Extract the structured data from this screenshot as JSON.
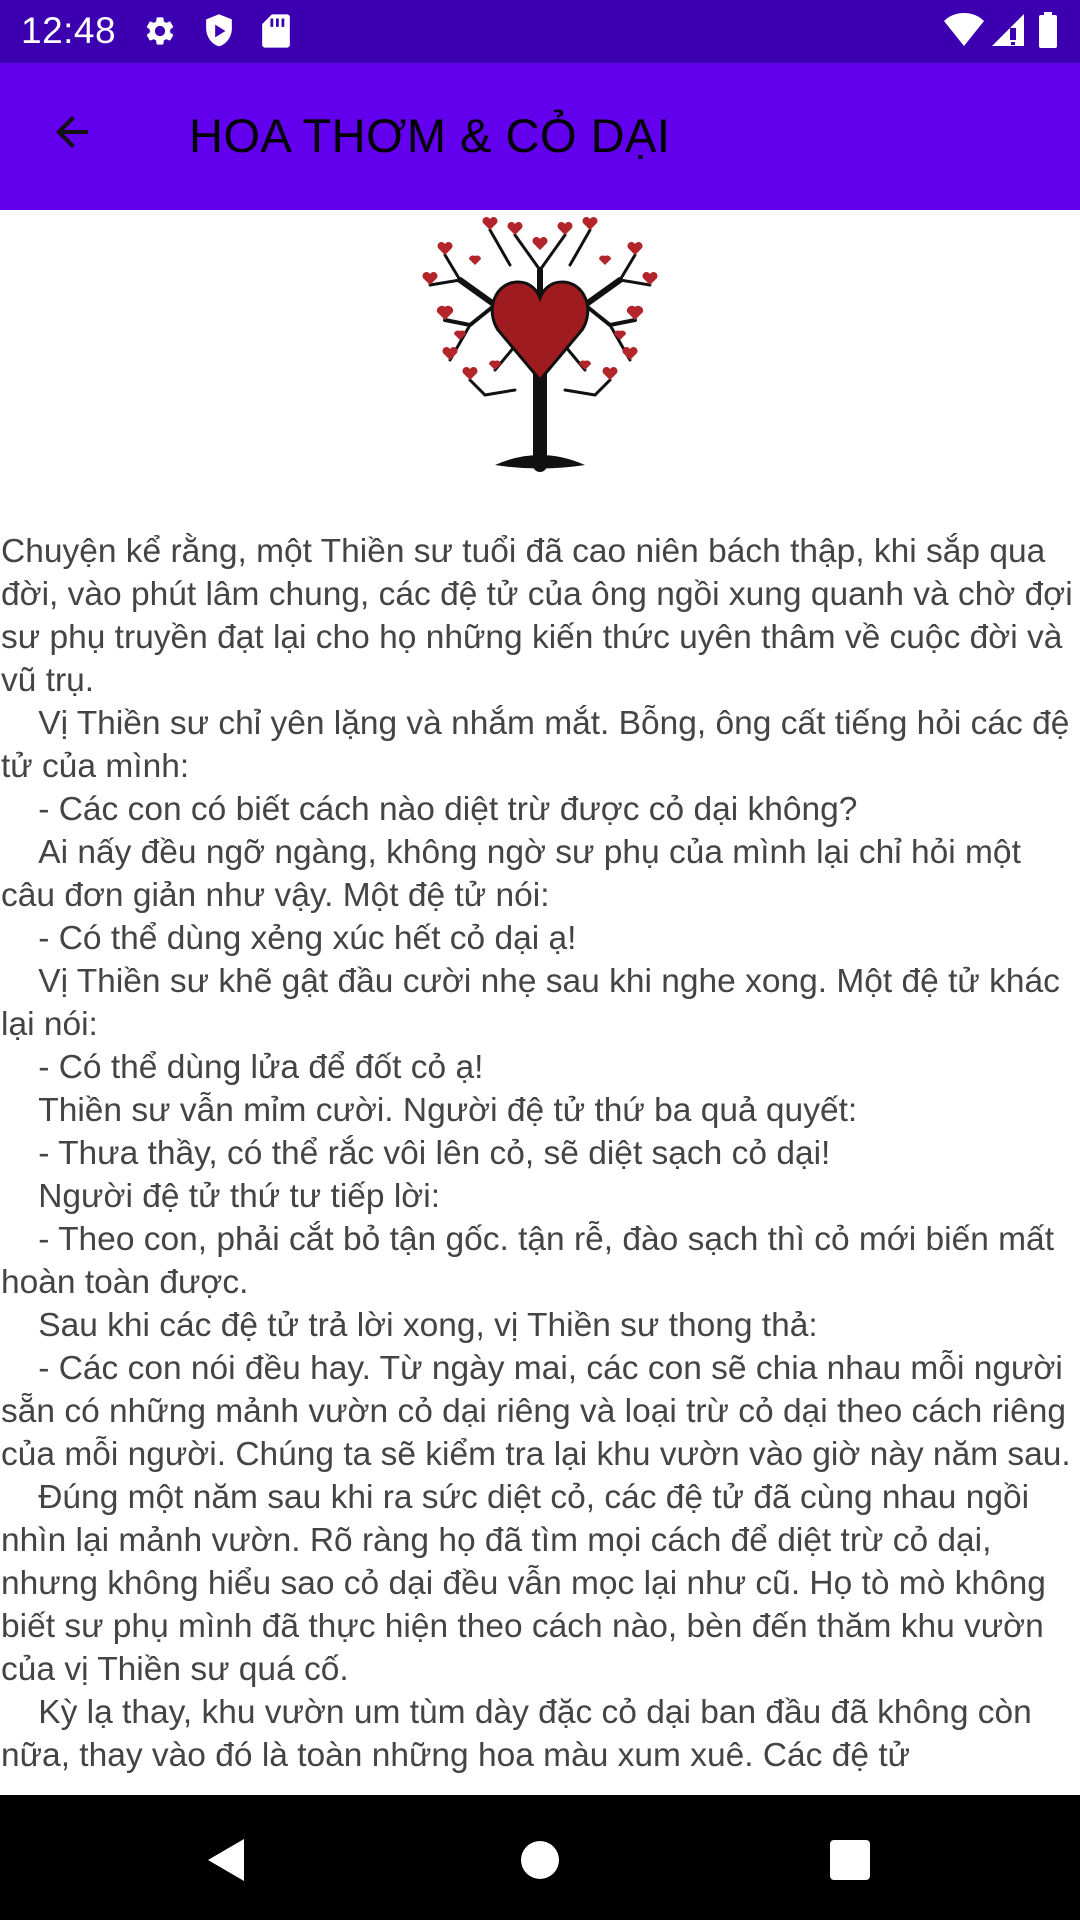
{
  "status_bar": {
    "time": "12:48",
    "icons_left": [
      "gear-icon",
      "shield-icon",
      "sd-card-icon"
    ],
    "icons_right": [
      "wifi-icon",
      "signal-icon",
      "battery-icon"
    ]
  },
  "app_bar": {
    "title": "HOA THƠM & CỎ DẠI",
    "back_icon": "arrow-back-icon"
  },
  "hero_image": {
    "icon": "heart-tree-illustration",
    "heart_color": "#9e1b1f"
  },
  "story": {
    "text": "Chuyện kể rằng, một Thiền sư tuổi đã cao niên bách thập, khi sắp qua đời, vào phút lâm chung, các đệ tử của ông ngồi xung quanh và chờ đợi sư phụ truyền đạt lại cho họ những kiến thức uyên thâm về cuộc đời và vũ trụ.\n    Vị Thiền sư chỉ yên lặng và nhắm mắt. Bỗng, ông cất tiếng hỏi các đệ tử của mình:\n    - Các con có biết cách nào diệt trừ được cỏ dại không?\n    Ai nấy đều ngỡ ngàng, không ngờ sư phụ của mình lại chỉ hỏi một câu đơn giản như vậy. Một đệ tử nói:\n    - Có thể dùng xẻng xúc hết cỏ dại ạ!\n    Vị Thiền sư khẽ gật đầu cười nhẹ sau khi nghe xong. Một đệ tử khác lại nói:\n    - Có thể dùng lửa để đốt cỏ ạ!\n    Thiền sư vẫn mỉm cười. Người đệ tử thứ ba quả quyết:\n    - Thưa thầy, có thể rắc vôi lên cỏ, sẽ diệt sạch cỏ dại!\n    Người đệ tử thứ tư tiếp lời:\n    - Theo con, phải cắt bỏ tận gốc. tận rễ, đào sạch thì cỏ mới biến mất hoàn toàn được.\n    Sau khi các đệ tử trả lời xong, vị Thiền sư thong thả:\n    - Các con nói đều hay. Từ ngày mai, các con sẽ chia nhau mỗi người sẵn có những mảnh vườn cỏ dại riêng và loại trừ cỏ dại theo cách riêng của mỗi người. Chúng ta sẽ kiểm tra lại khu vườn vào giờ này năm sau.\n    Đúng một năm sau khi ra sức diệt cỏ, các đệ tử đã cùng nhau ngồi nhìn lại mảnh vườn. Rõ ràng họ đã tìm mọi cách để diệt trừ cỏ dại, nhưng không hiểu sao cỏ dại đều vẫn mọc lại như cũ. Họ tò mò không biết sư phụ mình đã thực hiện theo cách nào, bèn đến thăm khu vườn của vị Thiền sư quá cố.\n    Kỳ lạ thay, khu vườn um tùm dày đặc cỏ dại ban đầu đã không còn nữa, thay vào đó là toàn những hoa màu xum xuê. Các đệ tử"
  },
  "nav_bar": {
    "icons": [
      "back-triangle-icon",
      "home-circle-icon",
      "recents-square-icon"
    ]
  }
}
